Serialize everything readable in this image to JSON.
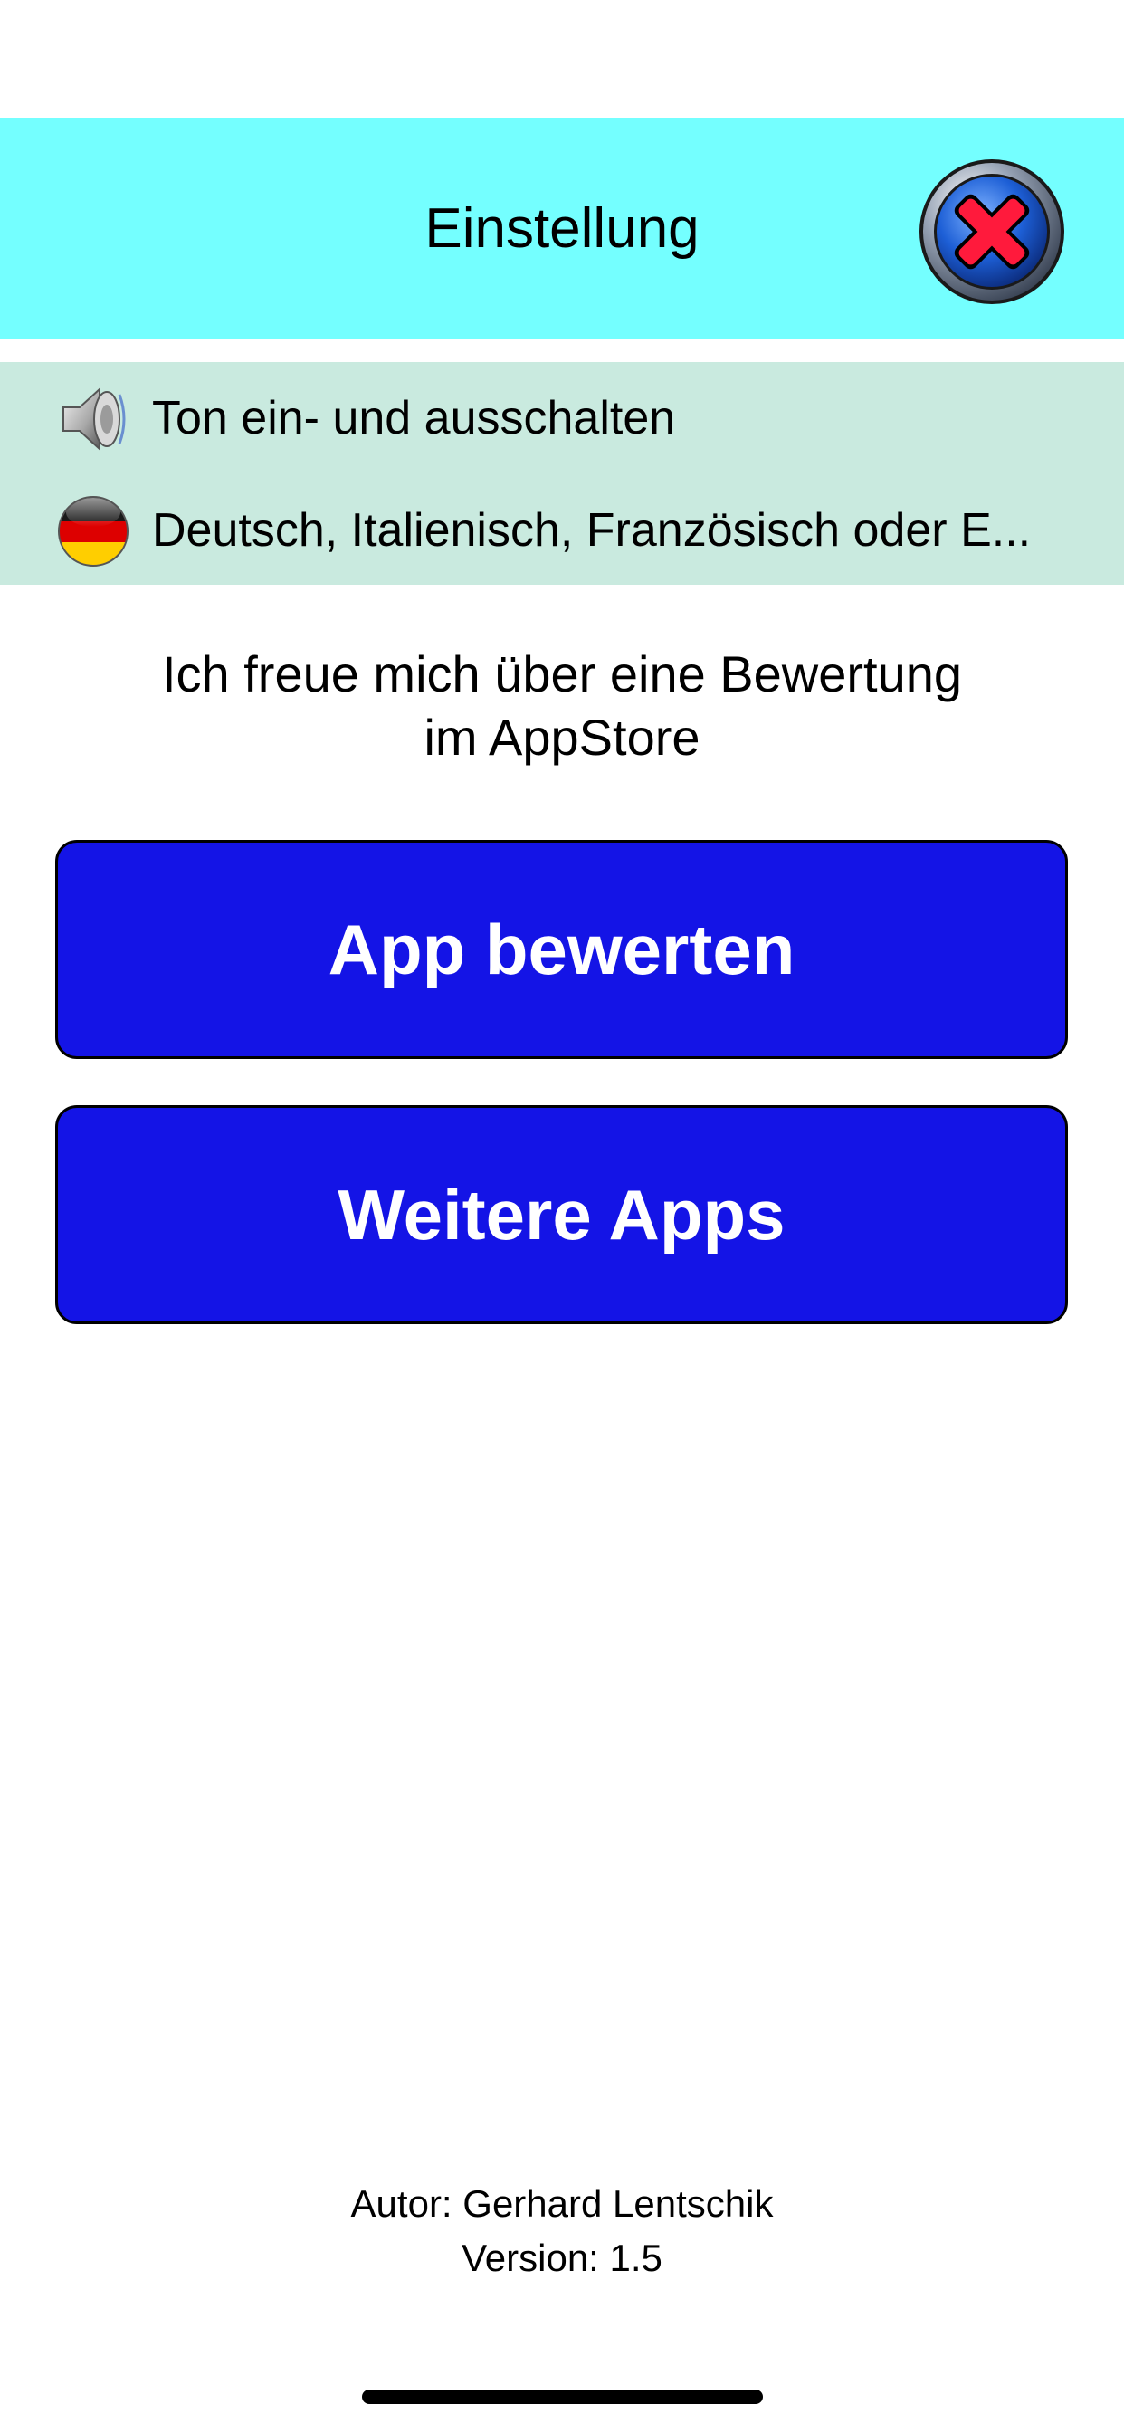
{
  "header": {
    "title": "Einstellung",
    "background_color": "#74FFFF",
    "close_icon": "close-x-icon"
  },
  "settings": {
    "background_color": "#C9EADF",
    "items": [
      {
        "icon": "speaker-icon",
        "label": "Ton ein- und ausschalten"
      },
      {
        "icon": "german-flag-icon",
        "label": "Deutsch, Italienisch, Französisch oder E..."
      }
    ]
  },
  "rating": {
    "line1": "Ich freue mich über eine Bewertung",
    "line2": "im AppStore"
  },
  "buttons": {
    "rate_label": "App bewerten",
    "more_label": "Weitere Apps",
    "color": "#1414E6"
  },
  "footer": {
    "author": "Autor: Gerhard Lentschik",
    "version": "Version: 1.5"
  }
}
